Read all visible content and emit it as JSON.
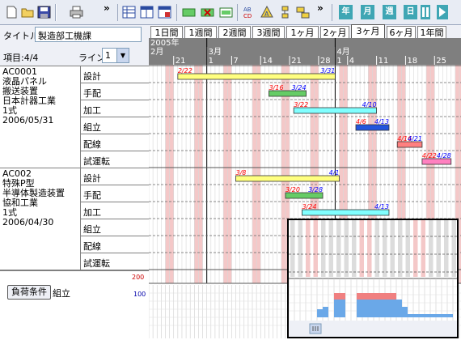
{
  "toolbar": {
    "icons": [
      "new-icon",
      "open-icon",
      "save-icon",
      "print-icon",
      "more-icon",
      "grid-view-icon",
      "split-view-icon",
      "report-icon",
      "bar-green-icon",
      "bar-delete-icon",
      "bar-edit-icon",
      "sort-icon",
      "tree-icon",
      "link-icon",
      "filter-icon",
      "more-icon-2"
    ],
    "nav_labels": [
      "年",
      "月",
      "週",
      "日",
      "",
      ""
    ]
  },
  "header": {
    "title_label": "タイトル",
    "title_value": "製造部工機課",
    "item_count": "項目:4/4",
    "line_label": "ライン",
    "line_value": "1"
  },
  "tabs": [
    "1日間",
    "1週間",
    "2週間",
    "3週間",
    "1ヶ月",
    "2ヶ月",
    "3ヶ月",
    "6ヶ月",
    "1年間"
  ],
  "active_tab": "3ヶ月",
  "timeline": {
    "year": "2005年",
    "months": [
      "2月",
      "3月",
      "4月"
    ],
    "days": [
      "21",
      "1",
      "7",
      "14",
      "21",
      "28",
      "1",
      "4",
      "11",
      "18",
      "25"
    ]
  },
  "projects": [
    {
      "code": "AC0001",
      "lines": [
        "液晶パネル",
        "搬送装置",
        "日本計器工業",
        "1式",
        "2006/05/31"
      ],
      "tasks": [
        {
          "name": "設計",
          "start": "2/22",
          "end": "3/31"
        },
        {
          "name": "手配",
          "start": "3/16",
          "end": "3/24"
        },
        {
          "name": "加工",
          "start": "3/22",
          "end": "4/10"
        },
        {
          "name": "組立",
          "start": "4/6",
          "end": "4/13"
        },
        {
          "name": "配線",
          "start": "4/16",
          "end": "4/21"
        },
        {
          "name": "試運転",
          "start": "4/22",
          "end": "4/28"
        }
      ]
    },
    {
      "code": "AC002",
      "lines": [
        "特殊P型",
        "半導体製造装置",
        "協和工業",
        "1式",
        "2006/04/30"
      ],
      "tasks": [
        {
          "name": "設計",
          "start": "3/8",
          "end": "4/1"
        },
        {
          "name": "手配",
          "start": "3/20",
          "end": "3/28"
        },
        {
          "name": "加工",
          "start": "3/24",
          "end": "4/13"
        },
        {
          "name": "組立",
          "start": "",
          "": "",
          "end": ""
        },
        {
          "name": "配線",
          "start": "",
          "end": ""
        },
        {
          "name": "試運転",
          "start": "",
          "end": ""
        }
      ]
    }
  ],
  "load": {
    "button": "負荷条件",
    "category": "組立",
    "scale_200": "200",
    "scale_100": "100"
  },
  "colors": {
    "bar_yellow": "#ffff80",
    "bar_green": "#66cc66",
    "bar_cyan": "#80ffff",
    "bar_blue": "#2255dd",
    "bar_red": "#ff8080",
    "bar_pink": "#ff80c0",
    "start_date": "#ff0000",
    "end_date": "#0000ff",
    "weekend": "#f4c8c8",
    "weekday_grid": "#d8d8d8",
    "load_bar": "#6aa8e8",
    "load_over": "#f08080"
  }
}
